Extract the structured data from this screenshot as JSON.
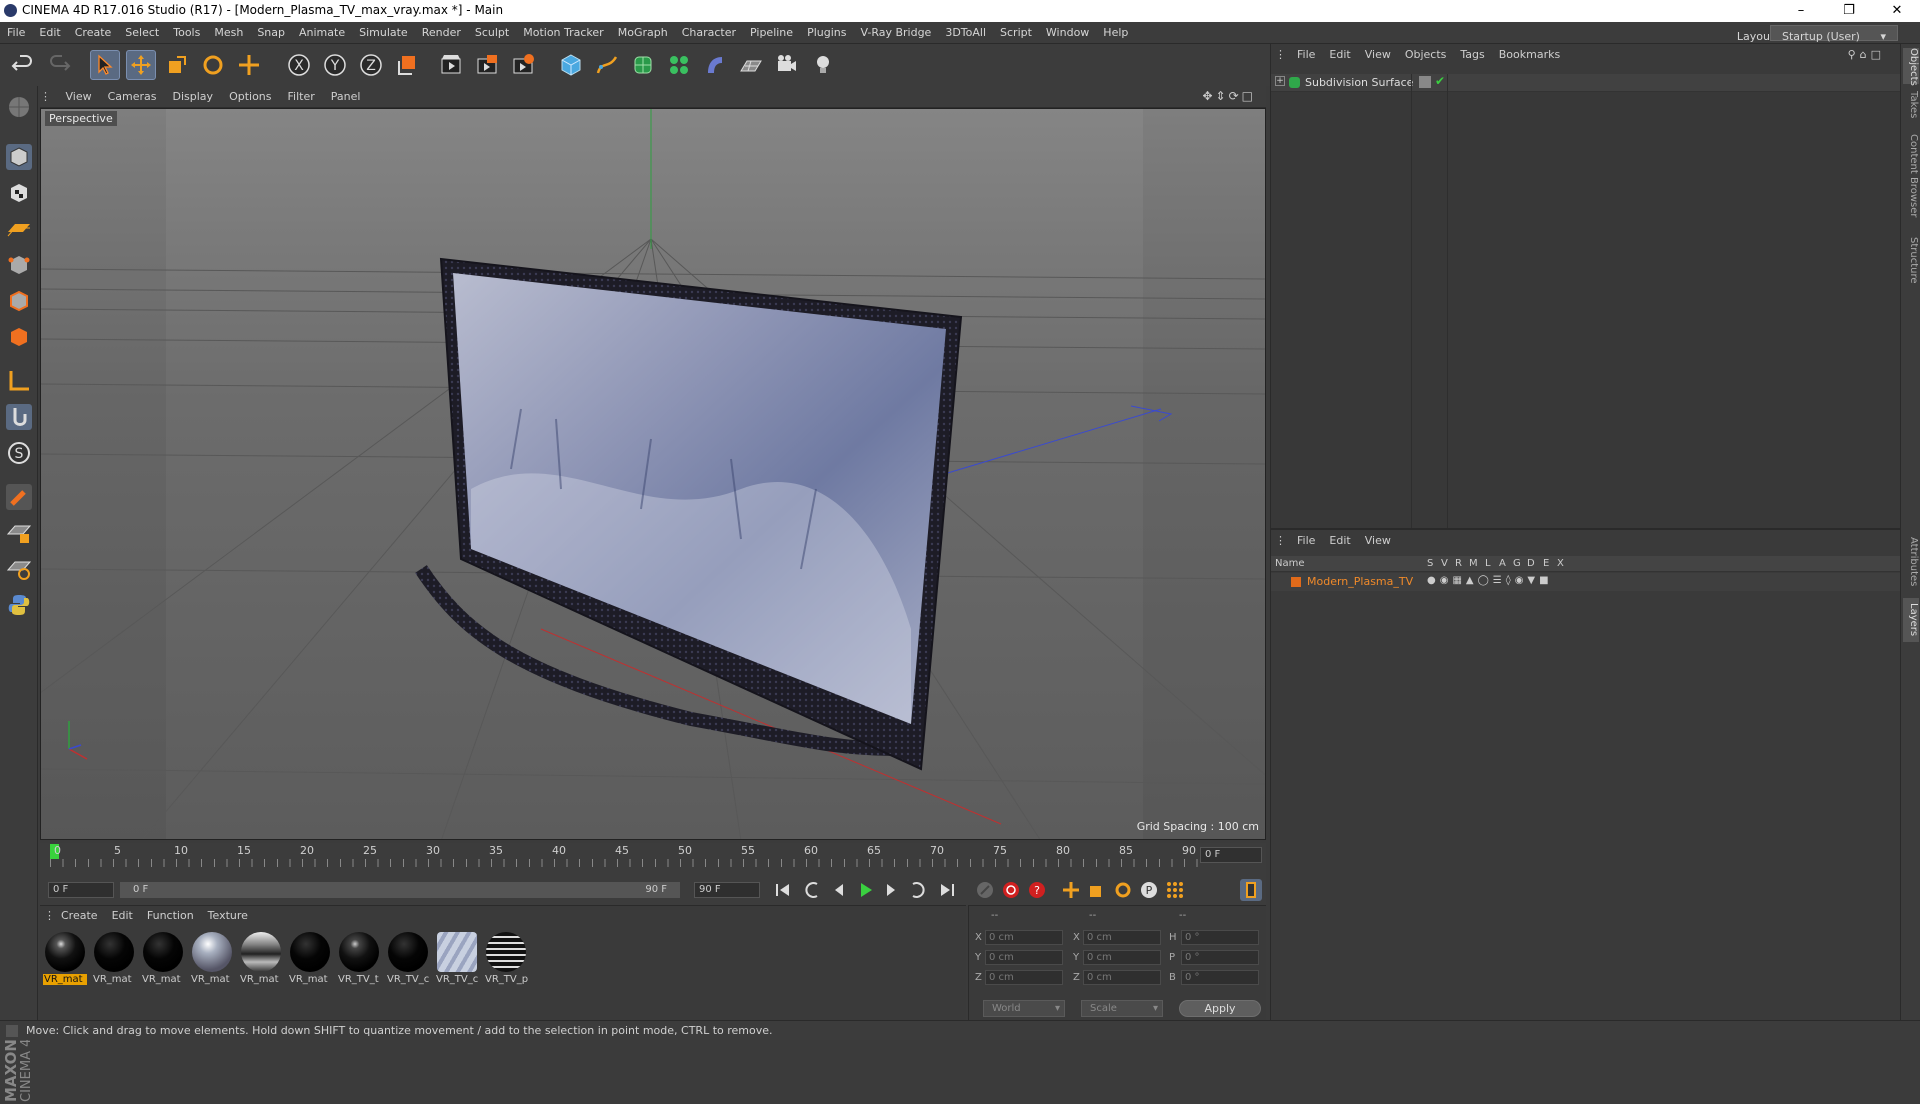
{
  "window": {
    "title": "CINEMA 4D R17.016 Studio (R17) - [Modern_Plasma_TV_max_vray.max *] - Main",
    "minimize": "–",
    "maximize": "❐",
    "close": "✕"
  },
  "menu": [
    "File",
    "Edit",
    "Create",
    "Select",
    "Tools",
    "Mesh",
    "Snap",
    "Animate",
    "Simulate",
    "Render",
    "Sculpt",
    "Motion Tracker",
    "MoGraph",
    "Character",
    "Pipeline",
    "Plugins",
    "V-Ray Bridge",
    "3DToAll",
    "Script",
    "Window",
    "Help"
  ],
  "layout": {
    "label": "Layout:",
    "value": "Startup (User)"
  },
  "toolbar_icons": [
    "undo-icon",
    "redo-icon",
    "select-arrow-icon",
    "move-icon",
    "scale-icon",
    "rotate-icon",
    "move-alt-icon",
    "x-axis-icon",
    "y-axis-icon",
    "z-axis-icon",
    "coordinate-system-icon",
    "render-view-icon",
    "render-picture-viewer-icon",
    "render-settings-icon",
    "cube-icon",
    "pen-icon",
    "subdivision-icon",
    "mograph-cloner-icon",
    "deformer-icon",
    "floor-icon",
    "camera-icon",
    "light-icon"
  ],
  "viewport": {
    "menu": [
      "View",
      "Cameras",
      "Display",
      "Options",
      "Filter",
      "Panel"
    ],
    "label": "Perspective",
    "grid_spacing": "Grid Spacing : 100 cm"
  },
  "timeline": {
    "ticks": [
      "0",
      "5",
      "10",
      "15",
      "20",
      "25",
      "30",
      "35",
      "40",
      "45",
      "50",
      "55",
      "60",
      "65",
      "70",
      "75",
      "80",
      "85",
      "90"
    ],
    "current_frame": "0 F",
    "start_field": "0 F",
    "range_start": "0 F",
    "range_end": "90 F",
    "end_field": "90 F",
    "end_box": "0 F"
  },
  "materials": {
    "menu": [
      "Create",
      "Edit",
      "Function",
      "Texture"
    ],
    "items": [
      {
        "name": "VR_mat",
        "selected": true,
        "style": "glossy-black"
      },
      {
        "name": "VR_mat",
        "selected": false,
        "style": "black"
      },
      {
        "name": "VR_mat",
        "selected": false,
        "style": "black"
      },
      {
        "name": "VR_mat",
        "selected": false,
        "style": "silver"
      },
      {
        "name": "VR_mat",
        "selected": false,
        "style": "chrome"
      },
      {
        "name": "VR_mat",
        "selected": false,
        "style": "black"
      },
      {
        "name": "VR_TV_t",
        "selected": false,
        "style": "glossy-black"
      },
      {
        "name": "VR_TV_c",
        "selected": false,
        "style": "black"
      },
      {
        "name": "VR_TV_c",
        "selected": false,
        "style": "texture-blue"
      },
      {
        "name": "VR_TV_p",
        "selected": false,
        "style": "pattern"
      }
    ]
  },
  "coordinates": {
    "header": [
      "--",
      "--",
      "--"
    ],
    "rows": [
      {
        "axis1": "X",
        "val1": "0 cm",
        "axis2": "X",
        "val2": "0 cm",
        "axis3": "H",
        "val3": "0 °"
      },
      {
        "axis1": "Y",
        "val1": "0 cm",
        "axis2": "Y",
        "val2": "0 cm",
        "axis3": "P",
        "val3": "0 °"
      },
      {
        "axis1": "Z",
        "val1": "0 cm",
        "axis2": "Z",
        "val2": "0 cm",
        "axis3": "B",
        "val3": "0 °"
      }
    ],
    "world": "World",
    "scale": "Scale",
    "apply": "Apply"
  },
  "objects": {
    "menu": [
      "File",
      "Edit",
      "View",
      "Objects",
      "Tags",
      "Bookmarks"
    ],
    "items": [
      {
        "name": "Subdivision Surface"
      }
    ]
  },
  "layers": {
    "menu": [
      "File",
      "Edit",
      "View"
    ],
    "columns": [
      "Name",
      "S",
      "V",
      "R",
      "M",
      "L",
      "A",
      "G",
      "D",
      "E",
      "X"
    ],
    "items": [
      {
        "name": "Modern_Plasma_TV",
        "color": "#e06a1a"
      }
    ]
  },
  "side_tabs": [
    "Objects",
    "Takes",
    "Content Browser",
    "Structure",
    "Attributes",
    "Layers"
  ],
  "status": "Move: Click and drag to move elements. Hold down SHIFT to quantize movement / add to the selection in point mode, CTRL to remove.",
  "branding": "MAXON CINEMA 4D",
  "colors": {
    "accent": "#7b8fb0",
    "selection": "#e8a000",
    "layer": "#e06a1a"
  }
}
